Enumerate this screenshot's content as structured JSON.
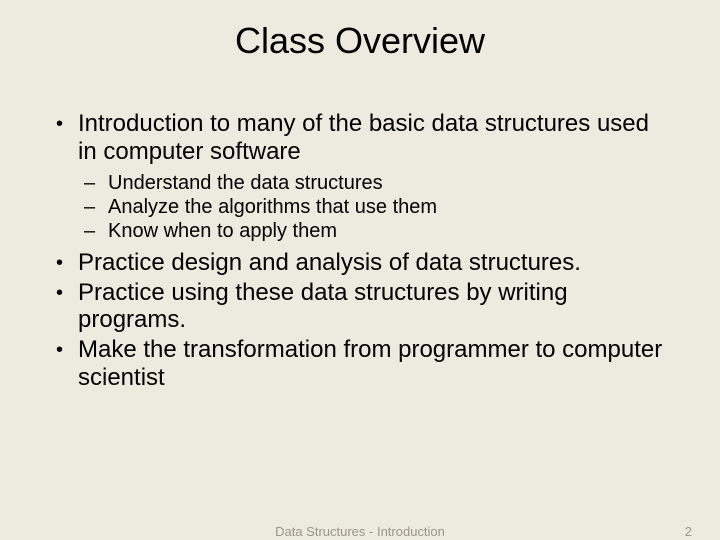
{
  "title": "Class Overview",
  "bullets": {
    "b0": "Introduction to many of the basic data structures used in computer software",
    "s0": "Understand the data structures",
    "s1": "Analyze the algorithms that use them",
    "s2": "Know when to apply them",
    "b1": "Practice design and analysis of data structures.",
    "b2": "Practice using these data structures by writing programs.",
    "b3": "Make the transformation from programmer to computer scientist"
  },
  "footer": {
    "text": "Data Structures - Introduction",
    "page": "2"
  }
}
